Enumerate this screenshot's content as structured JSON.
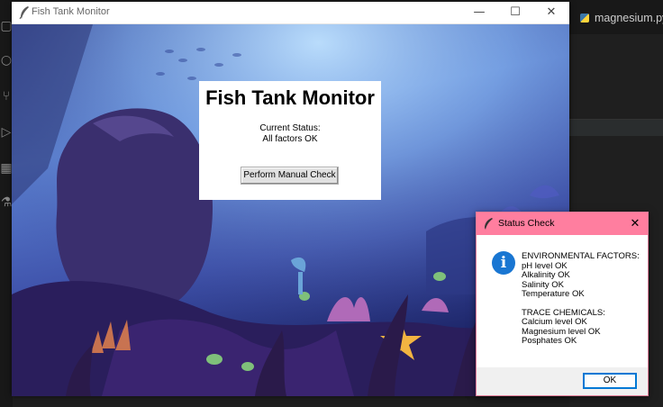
{
  "colors": {
    "titlebar_bg": "#ffffff",
    "dialog_titlebar_bg": "#ff7e9f",
    "info_icon": "#1976d2",
    "editor_bg": "#1f1f1f"
  },
  "editor": {
    "tab_label": "magnesium.py",
    "tab_icon": "python-file-icon",
    "activity_icons": [
      "files-icon",
      "search-icon",
      "source-control-icon",
      "run-debug-icon",
      "extensions-icon",
      "testing-icon"
    ]
  },
  "window": {
    "title": "Fish Tank Monitor",
    "icon": "feather-icon",
    "controls": {
      "minimize": "—",
      "maximize": "☐",
      "close": "✕"
    }
  },
  "panel": {
    "title": "Fish Tank Monitor",
    "status_label": "Current Status:",
    "status_value": "All factors OK",
    "check_button": "Perform Manual Check"
  },
  "dialog": {
    "title": "Status Check",
    "icon": "info-icon",
    "close": "✕",
    "env_header": "ENVIRONMENTAL FACTORS:",
    "env_items": [
      "pH level OK",
      "Alkalinity OK",
      "Salinity OK",
      "Temperature OK"
    ],
    "trace_header": "TRACE CHEMICALS:",
    "trace_items": [
      "Calcium level OK",
      "Magnesium level OK",
      "Posphates OK"
    ],
    "ok_button": "OK"
  }
}
